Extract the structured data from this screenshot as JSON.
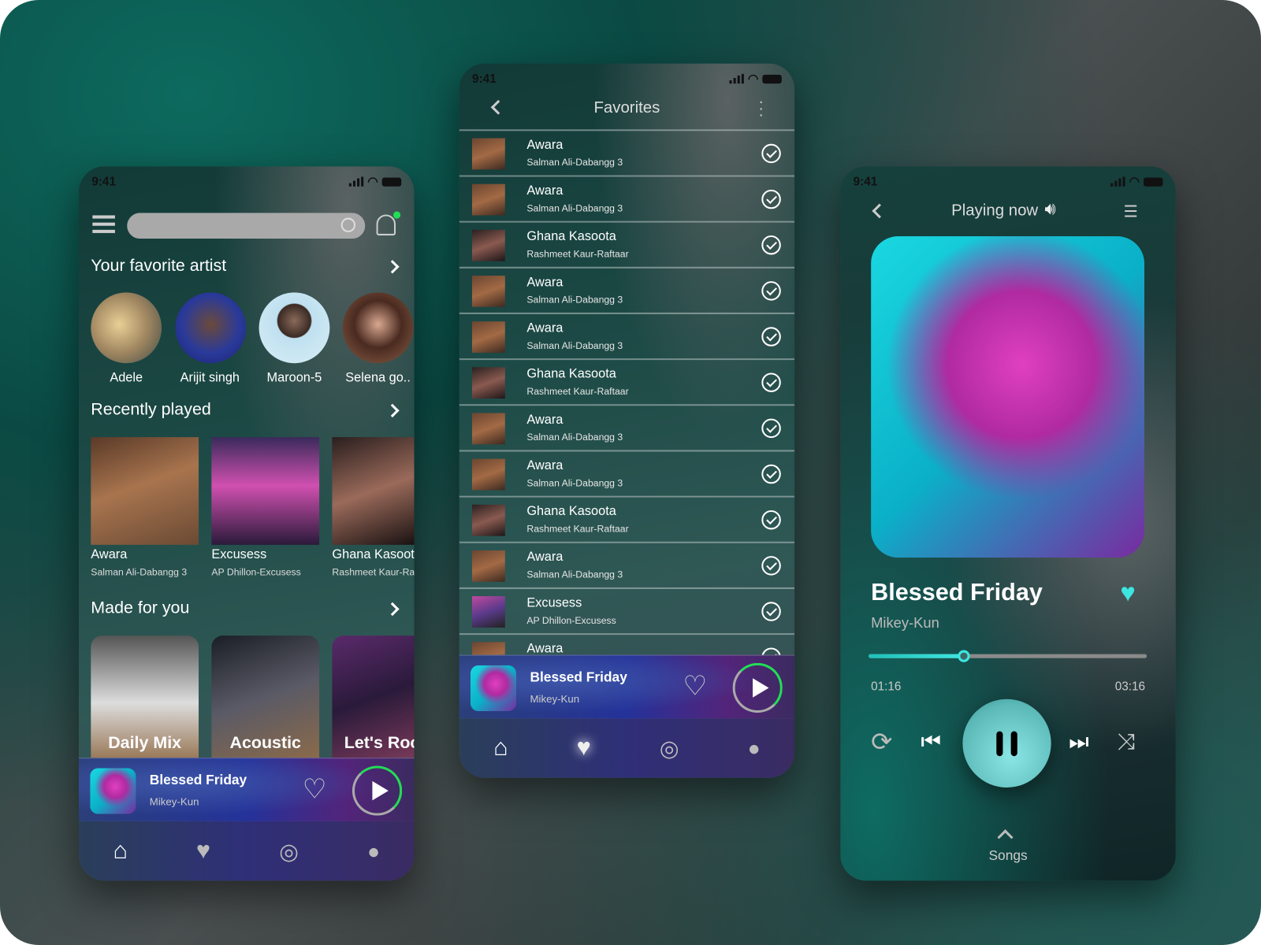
{
  "colors": {
    "accent": "#3ee6e0",
    "progress_ring": "#22dd55",
    "notification_dot": "#22dd55"
  },
  "status_time": "9:41",
  "home": {
    "search": {
      "placeholder": "",
      "icon": "search-icon"
    },
    "favorite_artist": {
      "title": "Your favorite artist",
      "artists": [
        {
          "name": "Adele"
        },
        {
          "name": "Arijit singh"
        },
        {
          "name": "Maroon-5"
        },
        {
          "name": "Selena go.."
        }
      ]
    },
    "recently_played": {
      "title": "Recently played",
      "items": [
        {
          "title": "Awara",
          "subtitle": "Salman Ali-Dabangg 3"
        },
        {
          "title": "Excusess",
          "subtitle": "AP Dhillon-Excusess"
        },
        {
          "title": "Ghana Kasoota",
          "subtitle": "Rashmeet Kaur-Raftaar"
        }
      ]
    },
    "made_for_you": {
      "title": "Made for you",
      "items": [
        {
          "label": "Daily Mix"
        },
        {
          "label": "Acoustic"
        },
        {
          "label": "Let's Rock"
        }
      ]
    }
  },
  "mini_player": {
    "title": "Blessed Friday",
    "artist": "Mikey-Kun"
  },
  "favorites": {
    "title": "Favorites",
    "items": [
      {
        "title": "Awara",
        "subtitle": "Salman Ali-Dabangg 3",
        "thumb": "aw"
      },
      {
        "title": "Awara",
        "subtitle": "Salman Ali-Dabangg 3",
        "thumb": "aw"
      },
      {
        "title": "Ghana Kasoota",
        "subtitle": "Rashmeet Kaur-Raftaar",
        "thumb": "gk"
      },
      {
        "title": "Awara",
        "subtitle": "Salman Ali-Dabangg 3",
        "thumb": "aw"
      },
      {
        "title": "Awara",
        "subtitle": "Salman Ali-Dabangg 3",
        "thumb": "aw"
      },
      {
        "title": "Ghana Kasoota",
        "subtitle": "Rashmeet Kaur-Raftaar",
        "thumb": "gk"
      },
      {
        "title": "Awara",
        "subtitle": "Salman Ali-Dabangg 3",
        "thumb": "aw"
      },
      {
        "title": "Awara",
        "subtitle": "Salman Ali-Dabangg 3",
        "thumb": "aw"
      },
      {
        "title": "Ghana Kasoota",
        "subtitle": "Rashmeet Kaur-Raftaar",
        "thumb": "gk"
      },
      {
        "title": "Awara",
        "subtitle": "Salman Ali-Dabangg 3",
        "thumb": "aw"
      },
      {
        "title": "Excusess",
        "subtitle": "AP Dhillon-Excusess",
        "thumb": "ex"
      },
      {
        "title": "Awara",
        "subtitle": "",
        "thumb": "aw"
      }
    ]
  },
  "now_playing": {
    "header": "Playing now",
    "title": "Blessed Friday",
    "artist": "Mikey-Kun",
    "elapsed": "01:16",
    "duration": "03:16",
    "progress": 0.34,
    "liked": true,
    "songs_label": "Songs"
  },
  "mini_progress": 0.12
}
